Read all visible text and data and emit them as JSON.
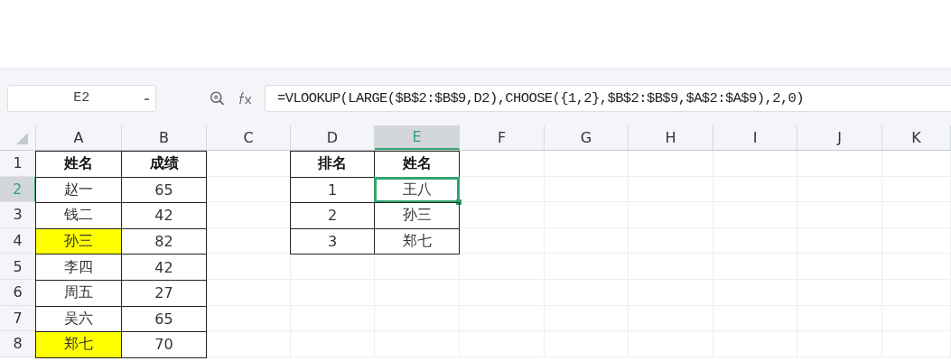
{
  "name_box": {
    "value": "E2"
  },
  "formula_bar": {
    "value": "=VLOOKUP(LARGE($B$2:$B$9,D2),CHOOSE({1,2},$B$2:$B$9,$A$2:$A$9),2,0)"
  },
  "columns": [
    {
      "label": "A",
      "selected": false
    },
    {
      "label": "B",
      "selected": false
    },
    {
      "label": "C",
      "selected": false
    },
    {
      "label": "D",
      "selected": false
    },
    {
      "label": "E",
      "selected": true
    },
    {
      "label": "F",
      "selected": false
    },
    {
      "label": "G",
      "selected": false
    },
    {
      "label": "H",
      "selected": false
    },
    {
      "label": "I",
      "selected": false
    },
    {
      "label": "J",
      "selected": false
    },
    {
      "label": "K",
      "selected": false
    }
  ],
  "rows": [
    {
      "number": "1",
      "selected": false,
      "cells": [
        {
          "text": "姓名",
          "bold": true,
          "highlighted": false,
          "selected": false
        },
        {
          "text": "成绩",
          "bold": true,
          "highlighted": false,
          "selected": false
        },
        null,
        {
          "text": "排名",
          "bold": true,
          "highlighted": false,
          "selected": false
        },
        {
          "text": "姓名",
          "bold": true,
          "highlighted": false,
          "selected": false
        }
      ]
    },
    {
      "number": "2",
      "selected": true,
      "cells": [
        {
          "text": "赵一",
          "bold": false,
          "highlighted": false,
          "selected": false
        },
        {
          "text": "65",
          "bold": false,
          "highlighted": false,
          "selected": false
        },
        null,
        {
          "text": "1",
          "bold": false,
          "highlighted": false,
          "selected": false
        },
        {
          "text": "王八",
          "bold": false,
          "highlighted": false,
          "selected": true
        }
      ]
    },
    {
      "number": "3",
      "selected": false,
      "cells": [
        {
          "text": "钱二",
          "bold": false,
          "highlighted": false,
          "selected": false
        },
        {
          "text": "42",
          "bold": false,
          "highlighted": false,
          "selected": false
        },
        null,
        {
          "text": "2",
          "bold": false,
          "highlighted": false,
          "selected": false
        },
        {
          "text": "孙三",
          "bold": false,
          "highlighted": false,
          "selected": false
        }
      ]
    },
    {
      "number": "4",
      "selected": false,
      "cells": [
        {
          "text": "孙三",
          "bold": false,
          "highlighted": true,
          "selected": false
        },
        {
          "text": "82",
          "bold": false,
          "highlighted": false,
          "selected": false
        },
        null,
        {
          "text": "3",
          "bold": false,
          "highlighted": false,
          "selected": false
        },
        {
          "text": "郑七",
          "bold": false,
          "highlighted": false,
          "selected": false
        }
      ]
    },
    {
      "number": "5",
      "selected": false,
      "cells": [
        {
          "text": "李四",
          "bold": false,
          "highlighted": false,
          "selected": false
        },
        {
          "text": "42",
          "bold": false,
          "highlighted": false,
          "selected": false
        }
      ]
    },
    {
      "number": "6",
      "selected": false,
      "cells": [
        {
          "text": "周五",
          "bold": false,
          "highlighted": false,
          "selected": false
        },
        {
          "text": "27",
          "bold": false,
          "highlighted": false,
          "selected": false
        }
      ]
    },
    {
      "number": "7",
      "selected": false,
      "cells": [
        {
          "text": "吴六",
          "bold": false,
          "highlighted": false,
          "selected": false
        },
        {
          "text": "65",
          "bold": false,
          "highlighted": false,
          "selected": false
        }
      ]
    },
    {
      "number": "8",
      "selected": false,
      "cells": [
        {
          "text": "郑七",
          "bold": false,
          "highlighted": true,
          "selected": false
        },
        {
          "text": "70",
          "bold": false,
          "highlighted": false,
          "selected": false
        }
      ]
    }
  ]
}
